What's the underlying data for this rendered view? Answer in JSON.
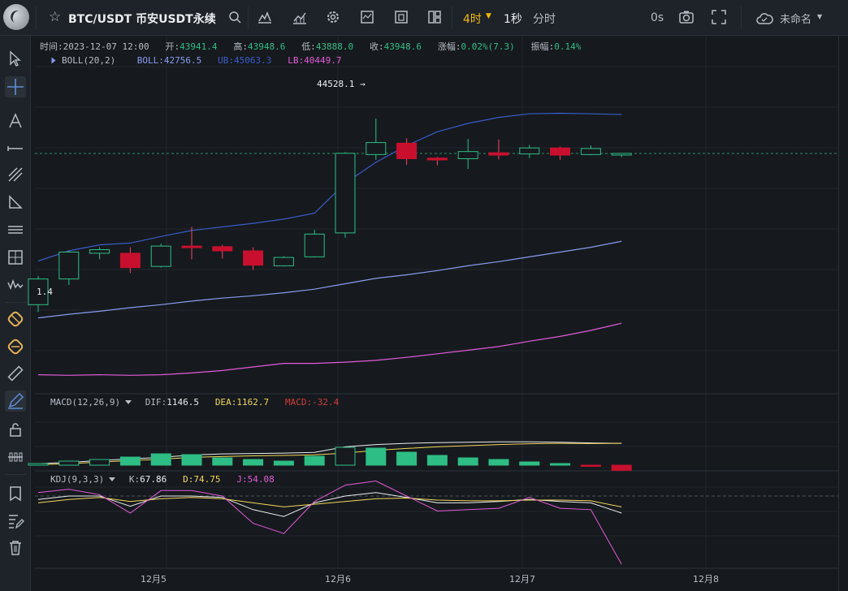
{
  "topbar": {
    "pair": "BTC/USDT 币安USDT永续",
    "timeframe_active": "4时",
    "timeframe_1s": "1秒",
    "timeframe_minute": "分时",
    "countdown": "0s",
    "layout_name": "未命名"
  },
  "legend": {
    "time_label": "时间:",
    "time_value": "2023-12-07 12:00",
    "open_label": "开:",
    "open_value": "43941.4",
    "high_label": "高:",
    "high_value": "43948.6",
    "low_label": "低:",
    "low_value": "43888.0",
    "close_label": "收:",
    "close_value": "43948.6",
    "change_label": "涨幅:",
    "change_value": "0.02%(7.3)",
    "amp_label": "振幅:",
    "amp_value": "0.14%"
  },
  "boll": {
    "name": "BOLL(20,2)",
    "mid_label": "BOLL:",
    "mid_value": "42756.5",
    "ub_label": "UB:",
    "ub_value": "45063.3",
    "lb_label": "LB:",
    "lb_value": "40449.7"
  },
  "macd": {
    "name": "MACD(12,26,9)",
    "dif_label": "DIF:",
    "dif_value": "1146.5",
    "dea_label": "DEA:",
    "dea_value": "1162.7",
    "macd_label": "MACD:",
    "macd_value": "-32.4"
  },
  "kdj": {
    "name": "KDJ(9,3,3)",
    "k_label": "K:",
    "k_value": "67.86",
    "d_label": "D:",
    "d_value": "74.75",
    "j_label": "J:",
    "j_value": "54.08"
  },
  "markers": {
    "high": "44528.1 →",
    "low": "1.4"
  },
  "x_axis": [
    "12月5",
    "12月6",
    "12月7",
    "12月8"
  ],
  "colors": {
    "up": "#2ebd85",
    "down": "#f6465d",
    "accent": "#f0b90b",
    "boll_mid": "#8a9bef",
    "boll_ub": "#3c5ac8",
    "boll_lb": "#e25bd8"
  },
  "icons": {
    "top": [
      "star-icon",
      "search-icon",
      "indicator-icon",
      "chart-type-icon",
      "settings-icon",
      "template-icon",
      "layout-icon",
      "multi-chart-icon",
      "camera-icon",
      "fullscreen-icon",
      "cloud-icon"
    ],
    "left": [
      "cursor-icon",
      "crosshair-icon",
      "text-icon",
      "horizontal-line-icon",
      "trend-line-icon",
      "triangle-icon",
      "parallel-lines-icon",
      "rectangle-icon",
      "wave-icon",
      "magnet-icon",
      "magnet-strong-icon",
      "ruler-icon",
      "pen-icon",
      "lock-icon",
      "show-hide-icon",
      "bookmark-icon",
      "edit-list-icon",
      "trash-icon"
    ]
  },
  "chart_data": {
    "type": "candlestick",
    "title": "",
    "x": [
      "12-04 08:00",
      "12-04 12:00",
      "12-04 16:00",
      "12-04 20:00",
      "12-05 00:00",
      "12-05 04:00",
      "12-05 08:00",
      "12-05 12:00",
      "12-05 16:00",
      "12-05 20:00",
      "12-06 00:00",
      "12-06 04:00",
      "12-06 08:00",
      "12-06 12:00",
      "12-06 16:00",
      "12-06 20:00",
      "12-07 00:00",
      "12-07 04:00",
      "12-07 08:00",
      "12-07 12:00"
    ],
    "series": [
      {
        "name": "OHLC",
        "values": [
          [
            41420,
            41900,
            41300,
            41850
          ],
          [
            41850,
            42320,
            41750,
            42300
          ],
          [
            42280,
            42380,
            42180,
            42340
          ],
          [
            42280,
            42380,
            41950,
            42040
          ],
          [
            42060,
            42440,
            42040,
            42400
          ],
          [
            42400,
            42720,
            42180,
            42380
          ],
          [
            42390,
            42420,
            42190,
            42320
          ],
          [
            42320,
            42380,
            42000,
            42080
          ],
          [
            42070,
            42230,
            42060,
            42210
          ],
          [
            42220,
            42670,
            42210,
            42600
          ],
          [
            42620,
            43970,
            42540,
            43950
          ],
          [
            43930,
            44530,
            43840,
            44130
          ],
          [
            44120,
            44200,
            43760,
            43860
          ],
          [
            43870,
            43890,
            43750,
            43840
          ],
          [
            43860,
            44190,
            43690,
            43980
          ],
          [
            43960,
            44180,
            43850,
            43920
          ],
          [
            43940,
            44090,
            43870,
            44040
          ],
          [
            44040,
            44060,
            43840,
            43920
          ],
          [
            43930,
            44080,
            43920,
            44030
          ],
          [
            43941.4,
            43948.6,
            43888.0,
            43948.6
          ]
        ]
      }
    ],
    "boll": {
      "mid": [
        41200,
        41260,
        41310,
        41370,
        41420,
        41480,
        41530,
        41570,
        41620,
        41680,
        41770,
        41860,
        41920,
        41990,
        42070,
        42140,
        42220,
        42300,
        42380,
        42480
      ],
      "ub": [
        42150,
        42320,
        42420,
        42450,
        42560,
        42660,
        42720,
        42780,
        42850,
        42950,
        43450,
        43800,
        44080,
        44310,
        44450,
        44550,
        44610,
        44620,
        44610,
        44600
      ],
      "lb": [
        40250,
        40240,
        40250,
        40240,
        40250,
        40280,
        40320,
        40380,
        40440,
        40440,
        40460,
        40490,
        40540,
        40600,
        40660,
        40720,
        40810,
        40890,
        40990,
        41110
      ]
    },
    "macd": {
      "dif": [
        40,
        70,
        120,
        160,
        200,
        260,
        290,
        300,
        310,
        330,
        470,
        530,
        560,
        580,
        590,
        600,
        600,
        590,
        570,
        560
      ],
      "dea": [
        10,
        40,
        80,
        120,
        150,
        200,
        220,
        240,
        250,
        265,
        310,
        380,
        430,
        470,
        500,
        530,
        550,
        560,
        555,
        560
      ],
      "hist": [
        10,
        25,
        35,
        50,
        70,
        65,
        45,
        35,
        25,
        55,
        110,
        105,
        80,
        60,
        45,
        35,
        20,
        10,
        -5,
        -32.4
      ]
    },
    "kdj": {
      "k": [
        75,
        80,
        80,
        65,
        80,
        80,
        78,
        60,
        50,
        70,
        80,
        85,
        78,
        70,
        70,
        72,
        75,
        72,
        70,
        55
      ],
      "d": [
        70,
        75,
        78,
        72,
        76,
        78,
        76,
        70,
        64,
        68,
        72,
        76,
        77,
        74,
        73,
        73,
        74,
        74,
        73,
        64
      ],
      "j": [
        85,
        90,
        82,
        55,
        88,
        88,
        80,
        40,
        25,
        72,
        96,
        102,
        80,
        58,
        60,
        62,
        78,
        62,
        60,
        -20
      ]
    },
    "ylim": [
      40000,
      45400
    ]
  }
}
